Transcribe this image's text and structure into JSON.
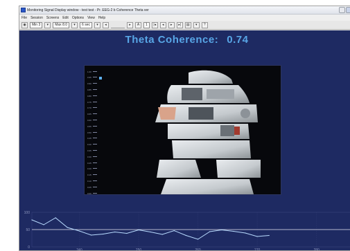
{
  "window": {
    "title": "Monitoring Signal Display window - test test - Pr. EEG-2 b Coherence Theta ver"
  },
  "menu": [
    "File",
    "Session",
    "Screens",
    "Edit",
    "Options",
    "View",
    "Help"
  ],
  "toolbar": {
    "field_min": "Min 3",
    "field_max": "Max 8.0",
    "field_speed": "6 sec",
    "page": "1"
  },
  "heading": {
    "label": "Theta Coherence:",
    "value": "0.74"
  },
  "colors": {
    "background": "#1e2a62",
    "heading": "#58a6e6",
    "trace": "#b9dcff",
    "threshold": "#e6e6f0"
  },
  "scale_ticks": [
    "1.00",
    "0.95",
    "0.90",
    "0.85",
    "0.80",
    "0.75",
    "0.70",
    "0.65",
    "0.60",
    "0.55",
    "0.50",
    "0.45",
    "0.40",
    "0.35",
    "0.30",
    "0.25",
    "0.20",
    "0.15",
    "0.10",
    "0.05",
    "0.00"
  ],
  "chart_data": {
    "type": "line",
    "y_tick_labels": [
      "100",
      "50",
      "0"
    ],
    "x_tick_labels": [
      "240",
      "250",
      "260",
      "270",
      "280"
    ],
    "threshold": 50,
    "ylim": [
      0,
      100
    ],
    "xlim": [
      232,
      286
    ],
    "x": [
      232,
      234,
      236,
      238,
      240,
      242,
      244,
      246,
      248,
      250,
      252,
      254,
      256,
      258,
      260,
      262,
      264,
      266,
      268,
      270,
      272
    ],
    "values": [
      78,
      64,
      84,
      56,
      46,
      34,
      37,
      43,
      39,
      49,
      43,
      36,
      47,
      33,
      22,
      44,
      49,
      45,
      40,
      30,
      33
    ]
  }
}
